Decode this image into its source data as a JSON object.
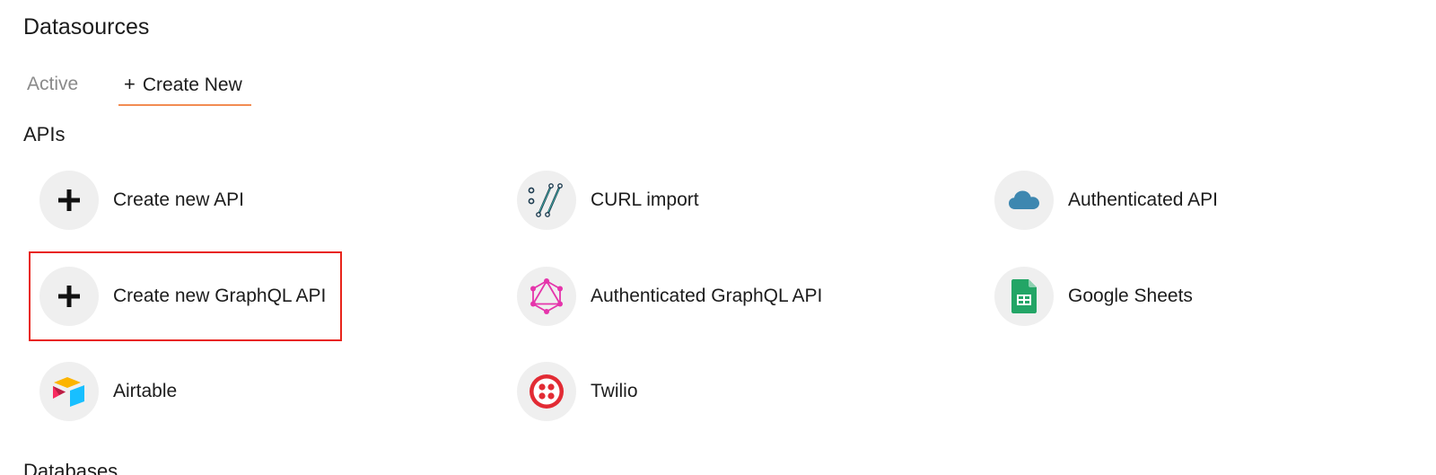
{
  "page": {
    "title": "Datasources"
  },
  "tabs": [
    {
      "label": "Active"
    },
    {
      "label": "Create New",
      "icon": "plus-icon"
    }
  ],
  "section": {
    "title": "APIs"
  },
  "cards": [
    {
      "label": "Create new API",
      "icon": "plus-icon"
    },
    {
      "label": "CURL import",
      "icon": "curl-icon"
    },
    {
      "label": "Authenticated API",
      "icon": "cloud-icon"
    },
    {
      "label": "Create new GraphQL API",
      "icon": "plus-icon"
    },
    {
      "label": "Authenticated GraphQL API",
      "icon": "graphql-icon"
    },
    {
      "label": "Google Sheets",
      "icon": "google-sheets-icon"
    },
    {
      "label": "Airtable",
      "icon": "airtable-icon"
    },
    {
      "label": "Twilio",
      "icon": "twilio-icon"
    }
  ],
  "next_section_partial": "Databases",
  "colors": {
    "tab_underline": "#f28c52",
    "highlight_border": "#e8241b",
    "icon_bg": "#efefef"
  }
}
